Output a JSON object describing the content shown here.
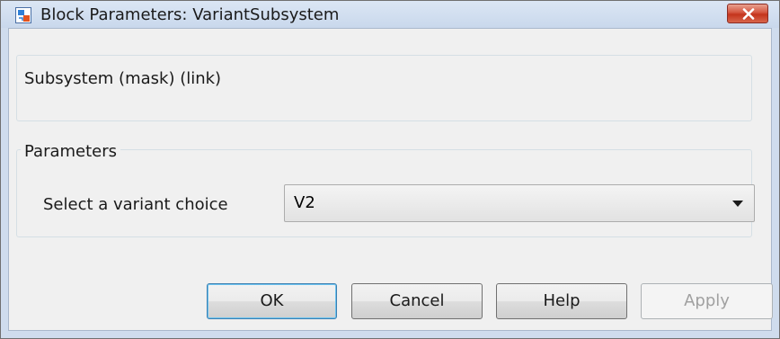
{
  "window": {
    "title": "Block Parameters: VariantSubsystem"
  },
  "groups": {
    "description": {
      "title": "Subsystem (mask) (link)"
    },
    "parameters": {
      "title": "Parameters"
    }
  },
  "variant": {
    "label": "Select a variant choice",
    "selected": "V2"
  },
  "buttons": {
    "ok": "OK",
    "cancel": "Cancel",
    "help": "Help",
    "apply": "Apply"
  },
  "icons": {
    "app": "simulink-block-icon",
    "close": "close-icon",
    "dropdown": "chevron-down-icon"
  },
  "colors": {
    "close_button": "#c4341c",
    "default_button_border": "#3c7fb1"
  }
}
